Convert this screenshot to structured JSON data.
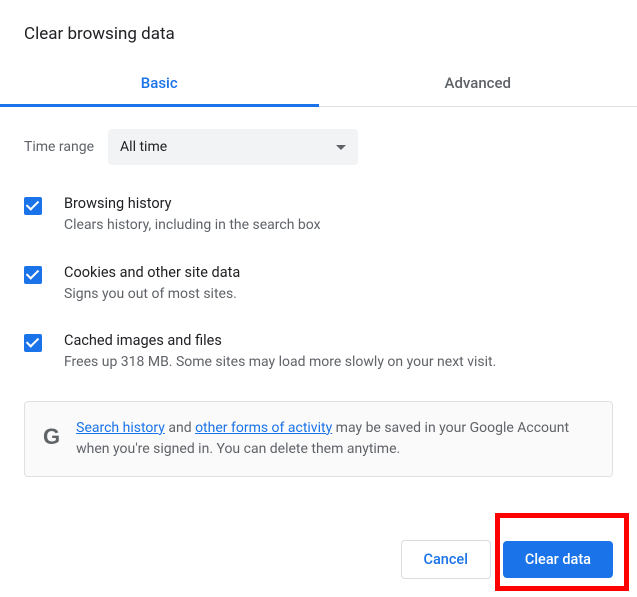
{
  "title": "Clear browsing data",
  "tabs": {
    "basic": "Basic",
    "advanced": "Advanced"
  },
  "timerange": {
    "label": "Time range",
    "value": "All time"
  },
  "options": [
    {
      "title": "Browsing history",
      "sub": "Clears history, including in the search box"
    },
    {
      "title": "Cookies and other site data",
      "sub": "Signs you out of most sites."
    },
    {
      "title": "Cached images and files",
      "sub": "Frees up 318 MB. Some sites may load more slowly on your next visit."
    }
  ],
  "notice": {
    "link1": "Search history",
    "mid1": " and ",
    "link2": "other forms of activity",
    "rest": " may be saved in your Google Account when you're signed in. You can delete them anytime."
  },
  "buttons": {
    "cancel": "Cancel",
    "clear": "Clear data"
  },
  "icons": {
    "google_g": "G"
  }
}
